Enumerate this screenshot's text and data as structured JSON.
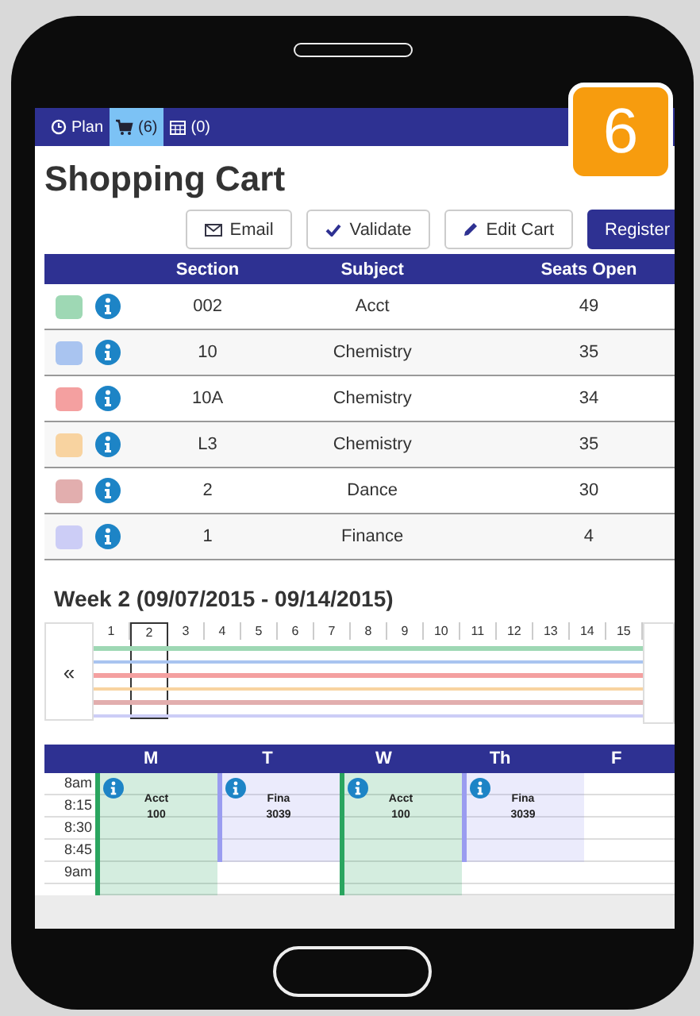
{
  "nav_tabs": [
    {
      "kind": "clock",
      "label": "Plan",
      "selected": false
    },
    {
      "kind": "cart",
      "label": "(6)",
      "selected": true
    },
    {
      "kind": "calendar",
      "label": "(0)",
      "selected": false
    }
  ],
  "badge": "6",
  "title": "Shopping Cart",
  "buttons": [
    {
      "kind": "email",
      "label": "Email"
    },
    {
      "kind": "check",
      "label": "Validate"
    },
    {
      "kind": "pencil",
      "label": "Edit Cart"
    },
    {
      "kind": "primary",
      "label": "Register"
    }
  ],
  "table": {
    "columns": [
      "Section",
      "Subject",
      "Seats Open"
    ],
    "rows": [
      {
        "color": "#9ed8b4",
        "section": "002",
        "subject": "Acct",
        "seats": "49"
      },
      {
        "color": "#a9c4f0",
        "section": "10",
        "subject": "Chemistry",
        "seats": "35"
      },
      {
        "color": "#f4a0a0",
        "section": "10A",
        "subject": "Chemistry",
        "seats": "34"
      },
      {
        "color": "#f8d3a0",
        "section": "L3",
        "subject": "Chemistry",
        "seats": "35"
      },
      {
        "color": "#e2aeae",
        "section": "2",
        "subject": "Dance",
        "seats": "30"
      },
      {
        "color": "#cccdf6",
        "section": "1",
        "subject": "Finance",
        "seats": "4"
      }
    ]
  },
  "week": {
    "title": "Week 2 (09/07/2015 - 09/14/2015)",
    "prev": "«",
    "weeks": [
      {
        "label": "1",
        "selected": false
      },
      {
        "label": "2",
        "selected": true
      },
      {
        "label": "3",
        "selected": false
      },
      {
        "label": "4",
        "selected": false
      },
      {
        "label": "5",
        "selected": false
      },
      {
        "label": "6",
        "selected": false
      },
      {
        "label": "7",
        "selected": false
      },
      {
        "label": "8",
        "selected": false
      },
      {
        "label": "9",
        "selected": false
      },
      {
        "label": "10",
        "selected": false
      },
      {
        "label": "11",
        "selected": false
      },
      {
        "label": "12",
        "selected": false
      },
      {
        "label": "13",
        "selected": false
      },
      {
        "label": "14",
        "selected": false
      },
      {
        "label": "15",
        "selected": false
      }
    ]
  },
  "schedule": {
    "days": [
      "M",
      "T",
      "W",
      "Th",
      "F"
    ],
    "times": [
      "8am",
      "8:15",
      "8:30",
      "8:45",
      "9am"
    ],
    "events": [
      {
        "kind": "long",
        "title": "Acct",
        "number": "100",
        "color": "#2aa55f"
      },
      {
        "kind": "short",
        "title": "Fina",
        "number": "3039",
        "color": "#9a9cf0"
      },
      {
        "kind": "long",
        "title": "Acct",
        "number": "100",
        "color": "#2aa55f"
      },
      {
        "kind": "short",
        "title": "Fina",
        "number": "3039",
        "color": "#9a9cf0"
      }
    ]
  }
}
